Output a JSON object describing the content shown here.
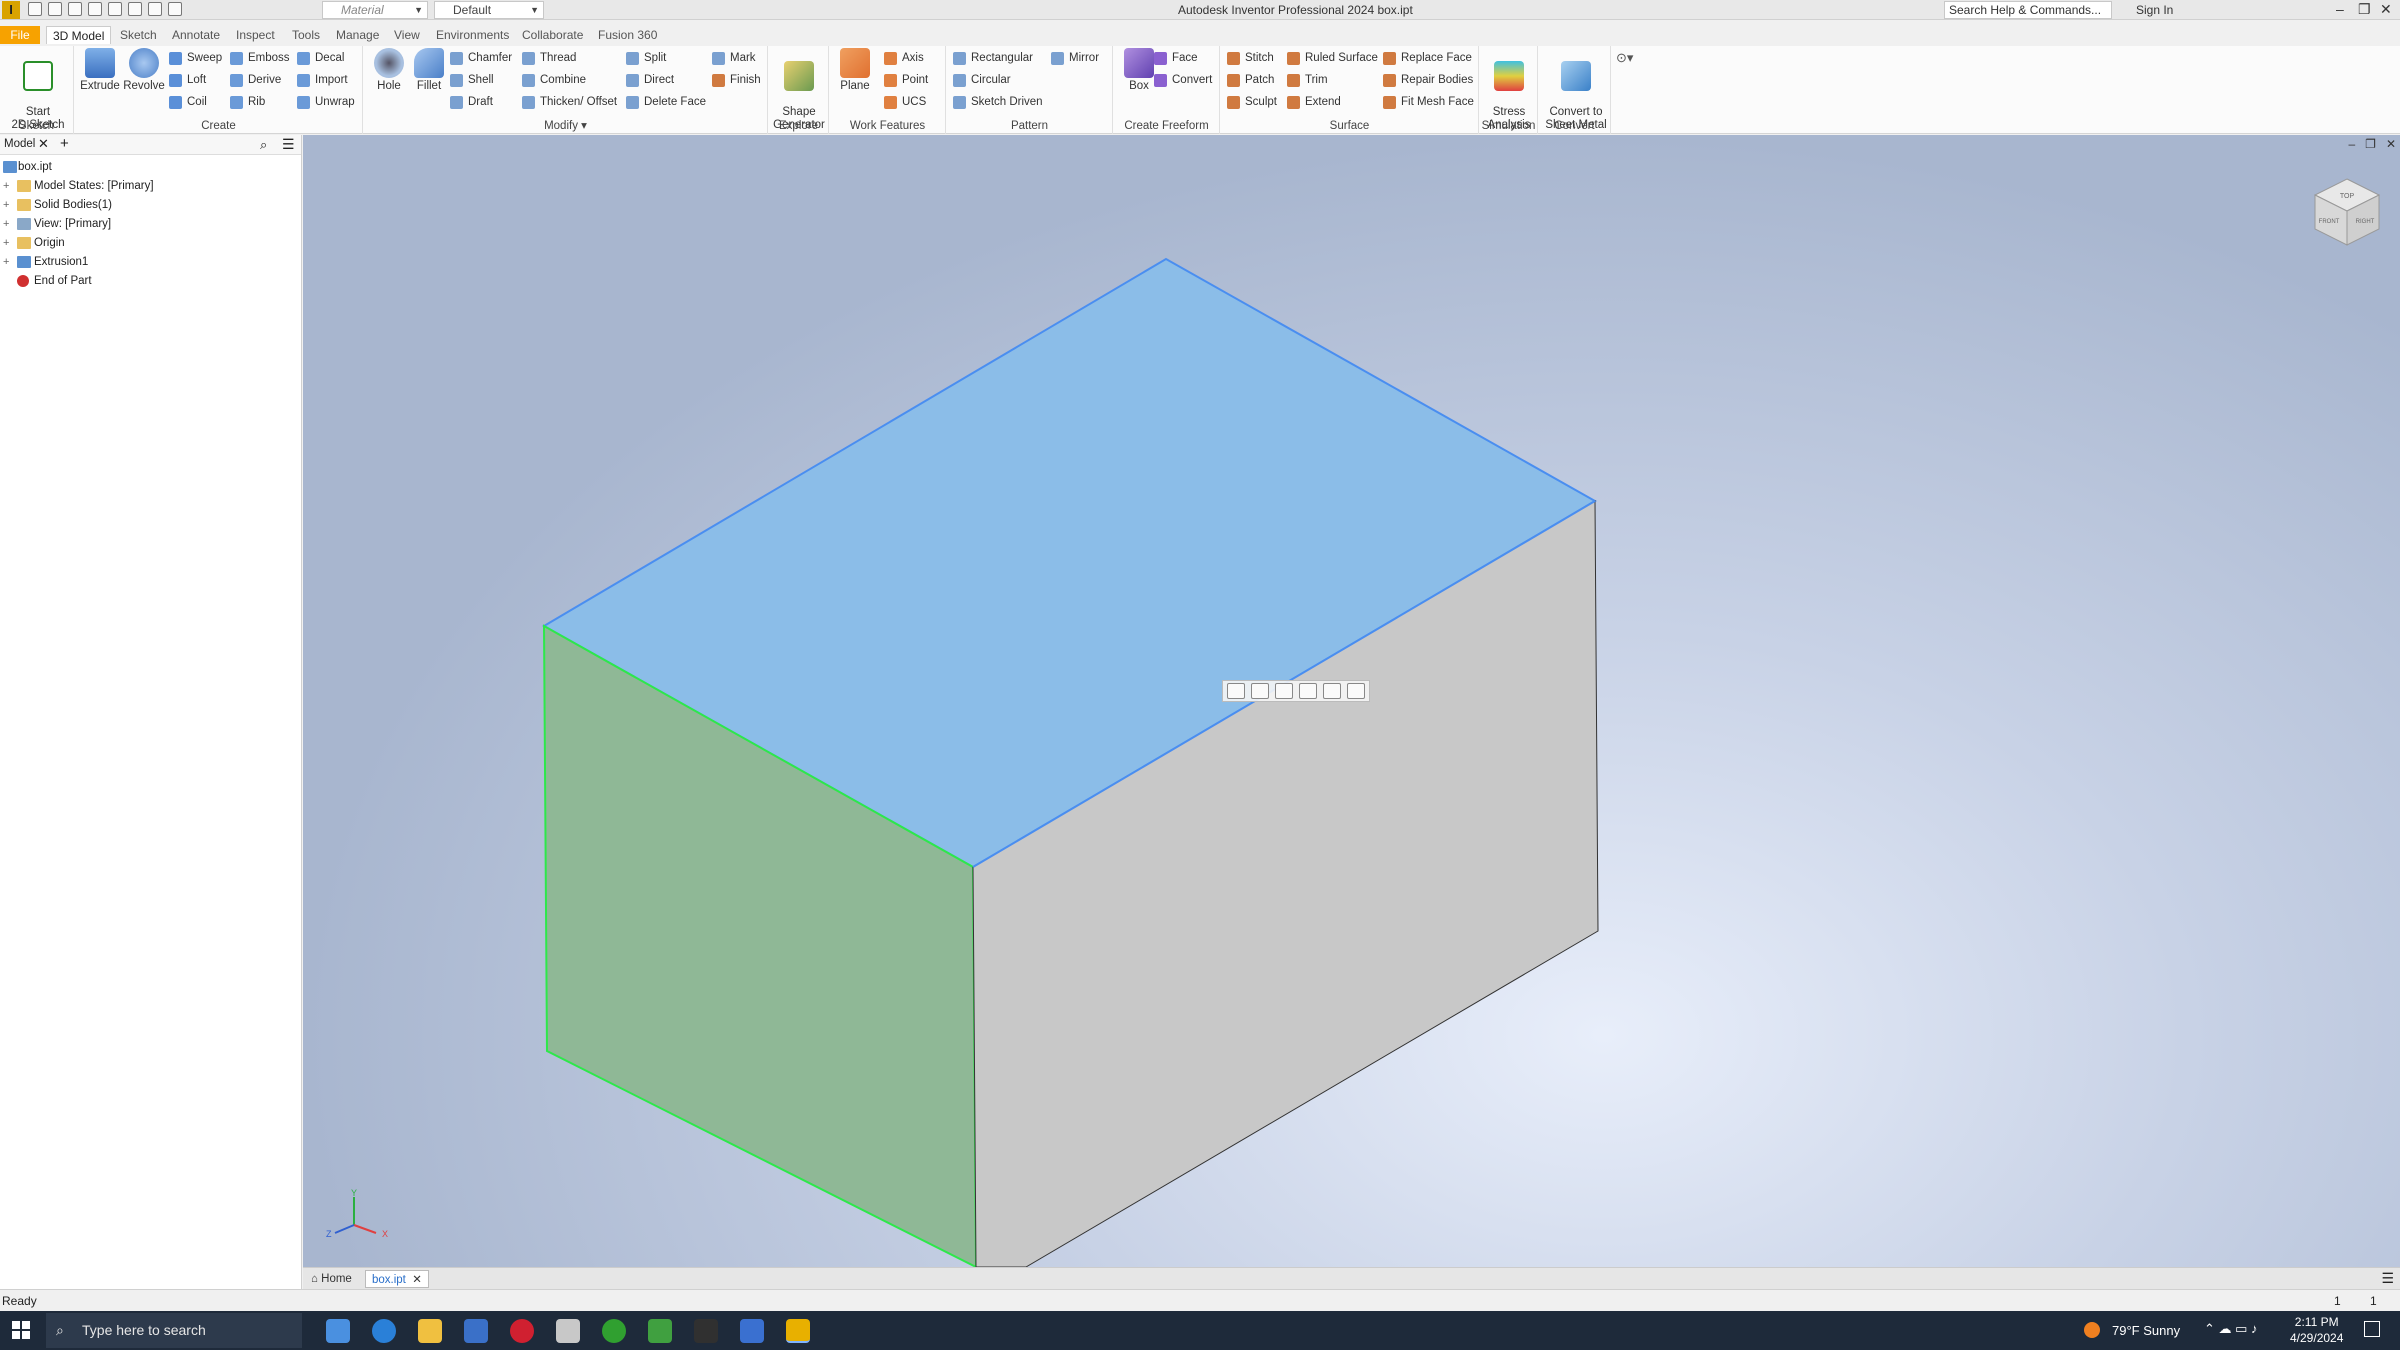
{
  "titlebar": {
    "app_logo": "I",
    "material_combo": "Material",
    "appearance_combo": "Default",
    "title": "Autodesk Inventor Professional 2024    box.ipt",
    "search_placeholder": "Search Help & Commands...",
    "sign_in": "Sign In",
    "minimize": "–",
    "restore": "❐",
    "close": "✕"
  },
  "tabs": {
    "file": "File",
    "model3d": "3D Model",
    "sketch": "Sketch",
    "annotate": "Annotate",
    "inspect": "Inspect",
    "tools": "Tools",
    "manage": "Manage",
    "view": "View",
    "environments": "Environments",
    "collaborate": "Collaborate",
    "fusion360": "Fusion 360"
  },
  "ribbon": {
    "sketch": {
      "label": "Sketch",
      "start_sketch": "Start\n2D Sketch"
    },
    "create": {
      "label": "Create",
      "extrude": "Extrude",
      "revolve": "Revolve",
      "sweep": "Sweep",
      "loft": "Loft",
      "coil": "Coil",
      "emboss": "Emboss",
      "derive": "Derive",
      "rib": "Rib",
      "decal": "Decal",
      "import": "Import",
      "unwrap": "Unwrap"
    },
    "modify": {
      "label": "Modify ▾",
      "hole": "Hole",
      "fillet": "Fillet",
      "chamfer": "Chamfer",
      "shell": "Shell",
      "draft": "Draft",
      "thread": "Thread",
      "combine": "Combine",
      "thicken": "Thicken/ Offset",
      "split": "Split",
      "direct": "Direct",
      "delete_face": "Delete Face",
      "mark": "Mark",
      "finish": "Finish"
    },
    "explore": {
      "label": "Explore",
      "shape_generator": "Shape\nGenerator"
    },
    "work_features": {
      "label": "Work Features",
      "plane": "Plane",
      "axis": "Axis",
      "point": "Point",
      "ucs": "UCS"
    },
    "pattern": {
      "label": "Pattern",
      "rectangular": "Rectangular",
      "circular": "Circular",
      "sketch_driven": "Sketch Driven",
      "mirror": "Mirror"
    },
    "freeform": {
      "label": "Create Freeform",
      "box": "Box",
      "face": "Face",
      "convert": "Convert"
    },
    "surface": {
      "label": "Surface",
      "stitch": "Stitch",
      "patch": "Patch",
      "sculpt": "Sculpt",
      "ruled_surface": "Ruled Surface",
      "trim": "Trim",
      "extend": "Extend",
      "replace_face": "Replace Face",
      "repair_bodies": "Repair Bodies",
      "fit_mesh_face": "Fit Mesh Face"
    },
    "simulation": {
      "label": "Simulation",
      "stress": "Stress\nAnalysis"
    },
    "convert": {
      "label": "Convert",
      "sheet_metal": "Convert to\nSheet Metal"
    }
  },
  "browser": {
    "tab": "Model",
    "items": [
      {
        "label": "box.ipt",
        "expander": ""
      },
      {
        "label": "Model States: [Primary]",
        "expander": "+"
      },
      {
        "label": "Solid Bodies(1)",
        "expander": "+"
      },
      {
        "label": "View: [Primary]",
        "expander": "+"
      },
      {
        "label": "Origin",
        "expander": "+"
      },
      {
        "label": "Extrusion1",
        "expander": "+"
      },
      {
        "label": "End of Part",
        "expander": ""
      }
    ]
  },
  "viewcube": {
    "top": "TOP",
    "front": "FRONT",
    "right": "RIGHT"
  },
  "triad": {
    "x": "X",
    "y": "Y",
    "z": "Z"
  },
  "doctabs": {
    "home": "Home",
    "box": "box.ipt"
  },
  "status": {
    "text": "Ready",
    "count1": "1",
    "count2": "1"
  },
  "taskbar": {
    "search": "Type here to search",
    "weather": "79°F  Sunny",
    "time": "2:11 PM",
    "date": "4/29/2024"
  },
  "colors": {
    "top_face": "#8bbde8",
    "front_face": "#8fb896",
    "right_face": "#c8c8c8",
    "accent": "#f7a200"
  }
}
